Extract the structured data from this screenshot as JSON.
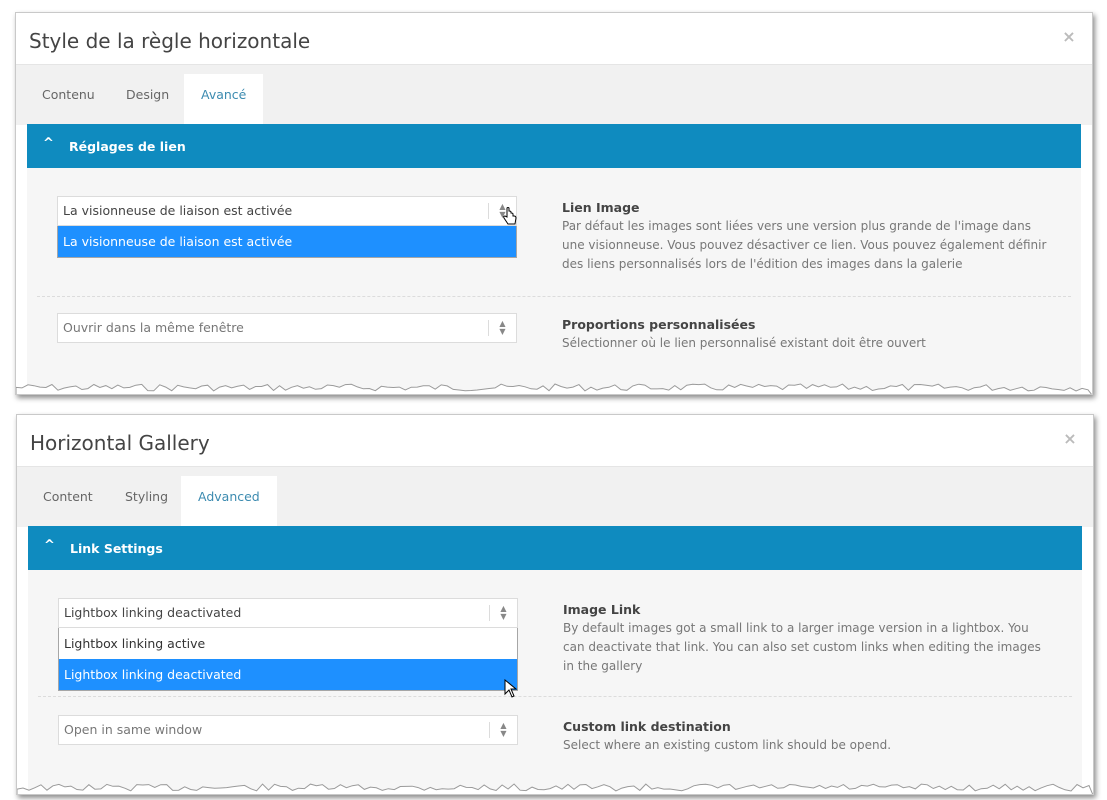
{
  "panel1": {
    "title": "Style de la règle horizontale",
    "close_icon": "×",
    "tabs": [
      "Contenu",
      "Design",
      "Avancé"
    ],
    "active_tab": "Avancé",
    "section": {
      "chevron": "^",
      "title": "Réglages de lien"
    },
    "link_select": {
      "value": "La visionneuse de liaison est activée",
      "options": [
        "La visionneuse de liaison est activée"
      ],
      "highlighted": "La visionneuse de liaison est activée"
    },
    "link_desc": {
      "label": "Lien Image",
      "text": "Par défaut les images sont liées vers une version plus grande de l'image dans une visionneuse. Vous pouvez désactiver ce lien. Vous pouvez également définir des liens personnalisés lors de l'édition des images dans la galerie"
    },
    "target_select": {
      "value": "Ouvrir dans la même fenêtre"
    },
    "target_desc": {
      "label": "Proportions personnalisées",
      "text": "Sélectionner où le lien personnalisé existant doit être ouvert"
    }
  },
  "panel2": {
    "title": "Horizontal Gallery",
    "close_icon": "×",
    "tabs": [
      "Content",
      "Styling",
      "Advanced"
    ],
    "active_tab": "Advanced",
    "section": {
      "chevron": "^",
      "title": "Link Settings"
    },
    "link_select": {
      "value": "Lightbox linking deactivated",
      "options": [
        "Lightbox linking active",
        "Lightbox linking deactivated"
      ],
      "highlighted": "Lightbox linking deactivated"
    },
    "link_desc": {
      "label": "Image Link",
      "text": "By default images got a small link to a larger image version in a lightbox. You can deactivate that link. You can also set custom links when editing the images in the gallery"
    },
    "target_select": {
      "value": "Open in same window"
    },
    "target_desc": {
      "label": "Custom link destination",
      "text": "Select where an existing custom link should be opend."
    }
  },
  "colors": {
    "accent": "#0f8bbf",
    "highlight": "#1e90ff",
    "tab_active_text": "#3c8bb0"
  }
}
